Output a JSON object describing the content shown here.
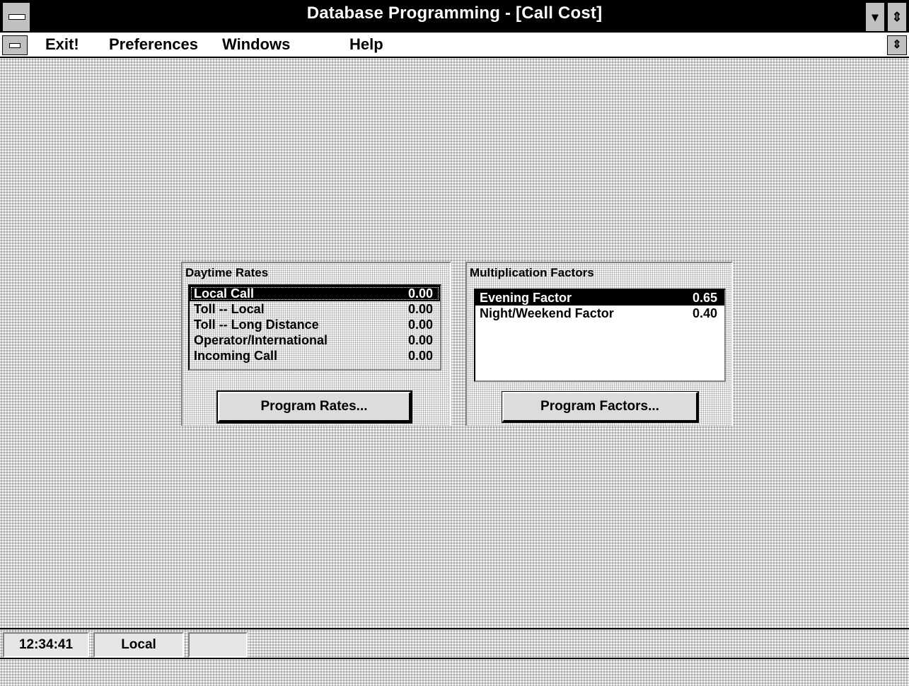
{
  "window": {
    "title": "Database Programming - [Call Cost]",
    "minimize_symbol": "▾",
    "maximize_symbol": "⇕",
    "restore_symbol": "⇕"
  },
  "menu": {
    "items": [
      {
        "label": "Exit!",
        "mnemonic": "x"
      },
      {
        "label": "Preferences",
        "mnemonic": "r"
      },
      {
        "label": "Windows",
        "mnemonic": "W"
      },
      {
        "label": "Help",
        "mnemonic": "H"
      }
    ]
  },
  "daytime_rates": {
    "title": "Daytime Rates",
    "rows": [
      {
        "label": "Local Call",
        "value": "0.00",
        "selected": true
      },
      {
        "label": "Toll -- Local",
        "value": "0.00"
      },
      {
        "label": "Toll -- Long Distance",
        "value": "0.00"
      },
      {
        "label": "Operator/International",
        "value": "0.00"
      },
      {
        "label": "Incoming Call",
        "value": "0.00"
      }
    ],
    "button_label": "Program Rates..."
  },
  "multiplication_factors": {
    "title": "Multiplication Factors",
    "rows": [
      {
        "label": "Evening Factor",
        "value": "0.65",
        "selected": true
      },
      {
        "label": "Night/Weekend Factor",
        "value": "0.40"
      }
    ],
    "button_label": "Program Factors..."
  },
  "status": {
    "time": "12:34:41",
    "mode": "Local",
    "extra": ""
  },
  "icons": {
    "system_menu": "system-menu-icon",
    "document_menu": "document-menu-icon"
  }
}
